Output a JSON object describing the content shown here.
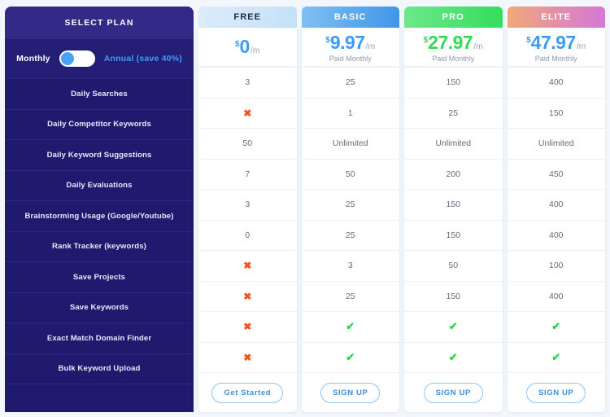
{
  "sidebar": {
    "title": "SELECT PLAN",
    "toggle": {
      "left_label": "Monthly",
      "right_label": "Annual (save 40%)",
      "state": "monthly"
    },
    "features": [
      "Daily Searches",
      "Daily Competitor Keywords",
      "Daily Keyword Suggestions",
      "Daily Evaluations",
      "Brainstorming Usage (Google/Youtube)",
      "Rank Tracker (keywords)",
      "Save Projects",
      "Save Keywords",
      "Exact Match Domain Finder",
      "Bulk Keyword Upload",
      ""
    ]
  },
  "colors": {
    "sidebar_bg": "#201a6e",
    "sidebar_head_bg": "#322a86",
    "page_bg": "#f3f7fb",
    "free_accent": "#3d9bf5",
    "basic_accent": "#3d9bf5",
    "pro_accent": "#2fdc52",
    "elite_accent": "#3d9bf5",
    "check": "#2ed24a",
    "cross": "#f4521e",
    "cta_border": "#8cc6f5",
    "cta_text": "#3d8fdc"
  },
  "plans": [
    {
      "name": "FREE",
      "header_gradient": "linear-gradient(90deg,#dcecfa 0%,#c4e1f7 100%)",
      "header_text_color": "#1f2a44",
      "currency": "$",
      "amount": "0",
      "period": "/m",
      "price_color": "#3d9bf5",
      "note": "",
      "cta": "Get Started",
      "values": [
        "3",
        "x",
        "50",
        "7",
        "3",
        "0",
        "x",
        "x",
        "x",
        "x"
      ]
    },
    {
      "name": "BASIC",
      "header_gradient": "linear-gradient(90deg,#7fc0f2 0%,#3f96e8 100%)",
      "header_text_color": "#ffffff",
      "currency": "$",
      "amount": "9.97",
      "period": "/m",
      "price_color": "#3d9bf5",
      "note": "Paid Monthly",
      "cta": "SIGN UP",
      "values": [
        "25",
        "1",
        "Unlimited",
        "50",
        "25",
        "25",
        "3",
        "25",
        "check",
        "check"
      ]
    },
    {
      "name": "PRO",
      "header_gradient": "linear-gradient(90deg,#6de88b 0%,#34dd5b 100%)",
      "header_text_color": "#ffffff",
      "currency": "$",
      "amount": "27.97",
      "period": "/m",
      "price_color": "#2fdc52",
      "note": "Paid Monthly",
      "cta": "SIGN UP",
      "values": [
        "150",
        "25",
        "Unlimited",
        "200",
        "150",
        "150",
        "50",
        "150",
        "check",
        "check"
      ]
    },
    {
      "name": "ELITE",
      "header_gradient": "linear-gradient(90deg,#f0a878 0%,#d577d8 100%)",
      "header_text_color": "#ffffff",
      "currency": "$",
      "amount": "47.97",
      "period": "/m",
      "price_color": "#3d9bf5",
      "note": "Paid Monthly",
      "cta": "SIGN UP",
      "values": [
        "400",
        "150",
        "Unlimited",
        "450",
        "400",
        "400",
        "100",
        "400",
        "check",
        "check"
      ]
    }
  ]
}
